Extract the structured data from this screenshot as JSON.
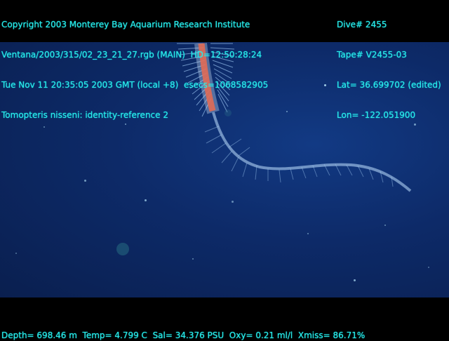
{
  "header": {
    "left_lines": [
      "Copyright 2003 Monterey Bay Aquarium Research Institute",
      "Ventana/2003/315/02_23_21_27.rgb (MAIN)  HD=12:50:28:24",
      "Tue Nov 11 20:35:05 2003 GMT (local +8)  esecs=1068582905",
      "Tomopteris nisseni: identity-reference 2"
    ],
    "right_lines": [
      "Dive# 2455",
      "Tape# V2455-03",
      "Lat= 36.699702 (edited)",
      "Lon= -122.051900"
    ]
  },
  "footer": {
    "telemetry": "Depth= 698.46 m  Temp= 4.799 C  Sal= 34.376 PSU  Oxy= 0.21 ml/l  Xmiss= 86.71%"
  },
  "colors": {
    "overlay_text": "#2ee6e6",
    "water": "#0d2a68",
    "animal_body": "#d8ecff",
    "animal_gut": "#e06a55"
  }
}
